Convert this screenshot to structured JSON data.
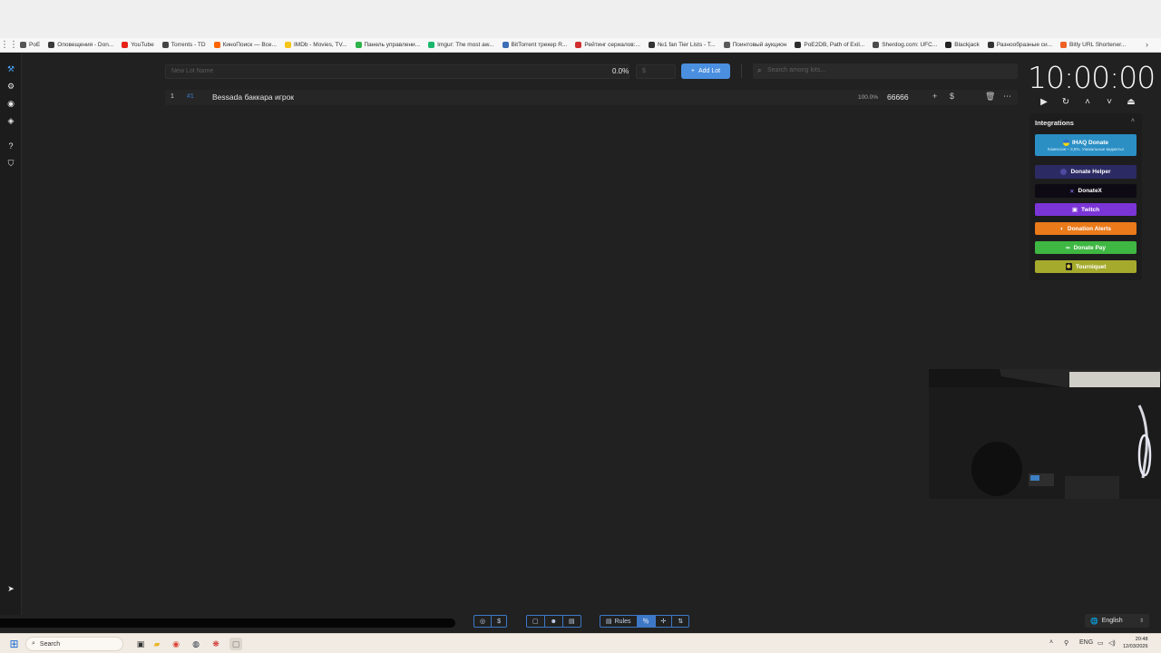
{
  "bookmarks": [
    {
      "label": "PoE",
      "color": "#555555"
    },
    {
      "label": "Оповещения - Don...",
      "color": "#3a3a3a"
    },
    {
      "label": "YouTube",
      "color": "#e62117"
    },
    {
      "label": "Torrents - TD",
      "color": "#444444"
    },
    {
      "label": "КиноПоиск — Все...",
      "color": "#ff6600"
    },
    {
      "label": "IMDb - Movies, TV...",
      "color": "#f5c518"
    },
    {
      "label": "Панель управлени...",
      "color": "#2cb34a"
    },
    {
      "label": "Imgur: The most aw...",
      "color": "#1bb76e"
    },
    {
      "label": "BitTorrent трекер R...",
      "color": "#3d6fb6"
    },
    {
      "label": "Рейтинг сериалов:...",
      "color": "#d12f2f"
    },
    {
      "label": "№1 fan Tier Lists - T...",
      "color": "#333333"
    },
    {
      "label": "Поинтовый аукцион",
      "color": "#5a5a5a"
    },
    {
      "label": "PoE2DB, Path of Exil...",
      "color": "#2b2b2b"
    },
    {
      "label": "Sherdog.com: UFC...",
      "color": "#4b4b4b"
    },
    {
      "label": "Blackjack",
      "color": "#222222"
    },
    {
      "label": "Разнообразные си...",
      "color": "#333333"
    },
    {
      "label": "Bitly URL Shortener...",
      "color": "#ee6123"
    }
  ],
  "toolbar": {
    "lot_placeholder": "New Lot Name",
    "percent": "0.0%",
    "amount_placeholder": "$",
    "add_lot_label": "Add Lot",
    "search_placeholder": "Search among lots..."
  },
  "lots": [
    {
      "index": "1",
      "id": "#1",
      "name": "Bessada баккара игрок",
      "percent": "100.0%",
      "amount": "66666"
    }
  ],
  "timer": {
    "value": "10:00:00"
  },
  "integrations": {
    "title": "Integrations",
    "ihaq_label": "IHAQ Donate",
    "ihaq_sub": "Комиссия – 3,5%. Уникальные виджеты!",
    "donate_helper": "Donate Helper",
    "donatex": "DonateX",
    "twitch": "Twitch",
    "donation_alerts": "Donation Alerts",
    "donate_pay": "Donate Pay",
    "tourniquet": "Tourniquet"
  },
  "bottombar": {
    "rules_label": "Rules",
    "language": "English"
  },
  "taskbar": {
    "search_label": "Search",
    "lang": "ENG",
    "time": "20:48",
    "date": "12/03/2026"
  }
}
